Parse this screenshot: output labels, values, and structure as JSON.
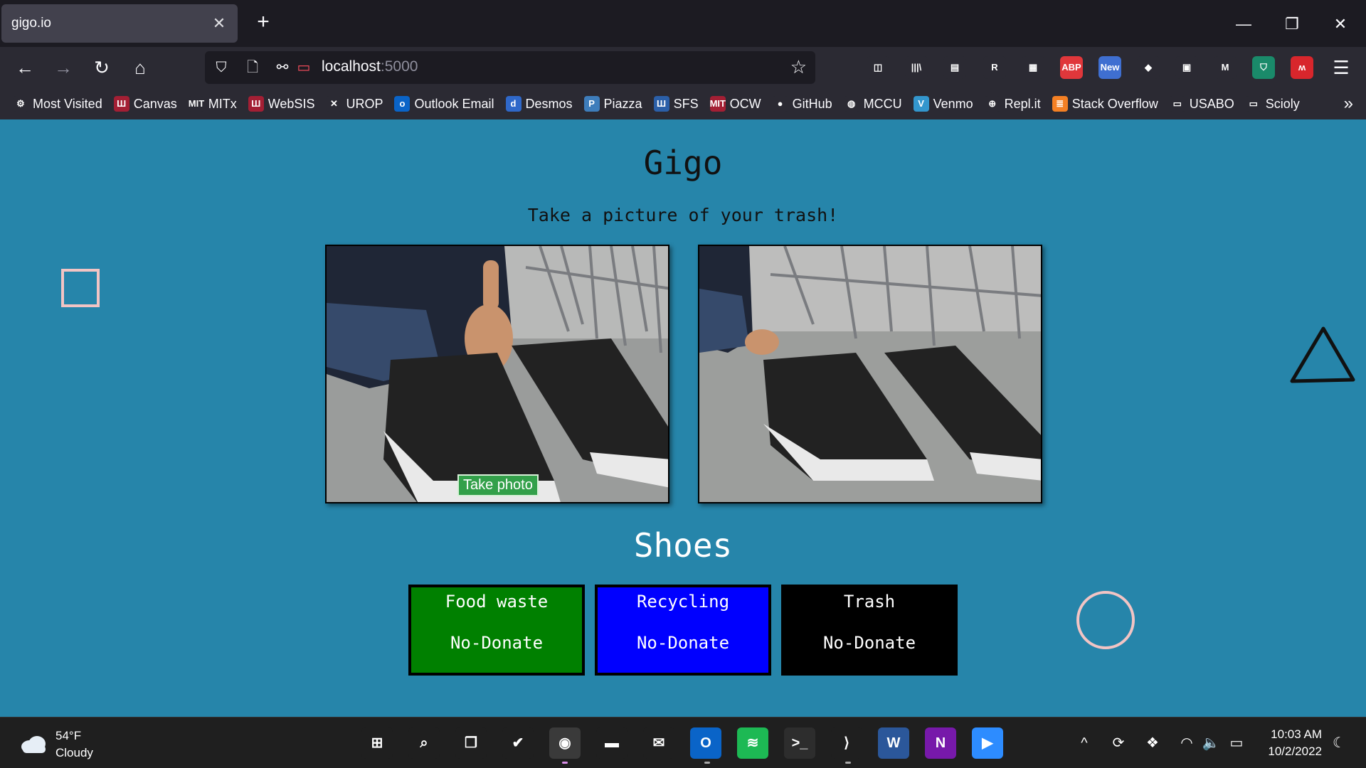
{
  "browser": {
    "tab_title": "gigo.io",
    "tab_close": "✕",
    "new_tab": "+",
    "url_host": "localhost",
    "url_port": ":5000",
    "window_controls": [
      "minimize-icon",
      "restore-icon",
      "close-icon"
    ],
    "nav_icons": [
      "back-arrow-icon",
      "forward-arrow-icon",
      "reload-icon",
      "home-icon"
    ],
    "extensions": [
      {
        "name": "pocket-icon",
        "label": "◫",
        "color": "#2b2a33"
      },
      {
        "name": "library-icon",
        "label": "|||\\",
        "color": "#2b2a33"
      },
      {
        "name": "sidebar-icon",
        "label": "▤",
        "color": "#2b2a33"
      },
      {
        "name": "readwise-extension-icon",
        "label": "R",
        "color": "#2b2a33"
      },
      {
        "name": "grid-extension-icon",
        "label": "▦",
        "color": "#2b2a33"
      },
      {
        "name": "adblock-plus-icon",
        "label": "ABP",
        "color": "#e0373b"
      },
      {
        "name": "new-extension-icon",
        "label": "New",
        "color": "#3f6fd1"
      },
      {
        "name": "gem-extension-icon",
        "label": "◆",
        "color": "#2b2a33"
      },
      {
        "name": "reader-extension-icon",
        "label": "▣",
        "color": "#2b2a33"
      },
      {
        "name": "m-extension-icon",
        "label": "M",
        "color": "#2b2a33"
      },
      {
        "name": "shield-extension-icon",
        "label": "⛉",
        "color": "#1a8a6a"
      },
      {
        "name": "mm-extension-icon",
        "label": "ʍ",
        "color": "#d8262c"
      }
    ],
    "menu_icon": "☰"
  },
  "bookmarks": [
    {
      "label": "Most Visited",
      "icon": "gear-icon",
      "glyph": "⚙",
      "color": "#2b2a33"
    },
    {
      "label": "Canvas",
      "icon": "canvas-icon",
      "glyph": "Ш",
      "color": "#a31f34"
    },
    {
      "label": "MITx",
      "icon": "mitx-icon",
      "glyph": "MIT",
      "color": "#2b2a33"
    },
    {
      "label": "WebSIS",
      "icon": "websis-icon",
      "glyph": "Ш",
      "color": "#a31f34"
    },
    {
      "label": "UROP",
      "icon": "urop-icon",
      "glyph": "✕",
      "color": "#2b2a33"
    },
    {
      "label": "Outlook Email",
      "icon": "outlook-icon",
      "glyph": "o",
      "color": "#0a64c8"
    },
    {
      "label": "Desmos",
      "icon": "desmos-icon",
      "glyph": "d",
      "color": "#2f68c9"
    },
    {
      "label": "Piazza",
      "icon": "piazza-icon",
      "glyph": "P",
      "color": "#3e7dbb"
    },
    {
      "label": "SFS",
      "icon": "sfs-icon",
      "glyph": "Ш",
      "color": "#2b5fa8"
    },
    {
      "label": "OCW",
      "icon": "ocw-icon",
      "glyph": "MIT",
      "color": "#a31f34"
    },
    {
      "label": "GitHub",
      "icon": "github-icon",
      "glyph": "●",
      "color": "#2b2a33"
    },
    {
      "label": "MCCU",
      "icon": "mccu-icon",
      "glyph": "◍",
      "color": "#2b2a33"
    },
    {
      "label": "Venmo",
      "icon": "venmo-icon",
      "glyph": "V",
      "color": "#3396cd"
    },
    {
      "label": "Repl.it",
      "icon": "globe-icon",
      "glyph": "⊕",
      "color": "#2b2a33"
    },
    {
      "label": "Stack Overflow",
      "icon": "stackoverflow-icon",
      "glyph": "≣",
      "color": "#f48024"
    },
    {
      "label": "USABO",
      "icon": "folder-icon",
      "glyph": "▭",
      "color": "#2b2a33"
    },
    {
      "label": "Scioly",
      "icon": "folder-icon",
      "glyph": "▭",
      "color": "#2b2a33"
    }
  ],
  "page": {
    "title": "Gigo",
    "subtitle": "Take a picture of your trash!",
    "take_photo": "Take photo",
    "result": "Shoes",
    "background": "#2685aa",
    "cards": [
      {
        "category": "Food waste",
        "donate": "No-Donate",
        "color": "#008000"
      },
      {
        "category": "Recycling",
        "donate": "No-Donate",
        "color": "#0000ff"
      },
      {
        "category": "Trash",
        "donate": "No-Donate",
        "color": "#000000"
      }
    ]
  },
  "taskbar": {
    "weather_temp": "54°F",
    "weather_desc": "Cloudy",
    "time": "10:03 AM",
    "date": "10/2/2022",
    "apps": [
      {
        "name": "start-icon",
        "glyph": "⊞",
        "color": "#1f1f1f"
      },
      {
        "name": "search-icon",
        "glyph": "⌕",
        "color": "#1f1f1f"
      },
      {
        "name": "task-view-icon",
        "glyph": "❐",
        "color": "#1f1f1f"
      },
      {
        "name": "todo-icon",
        "glyph": "✔",
        "color": "#1f1f1f"
      },
      {
        "name": "firefox-icon",
        "glyph": "◉",
        "color": "#3a3a3a"
      },
      {
        "name": "file-explorer-icon",
        "glyph": "▬",
        "color": "#1f1f1f"
      },
      {
        "name": "mail-icon",
        "glyph": "✉",
        "color": "#1f1f1f"
      },
      {
        "name": "outlook-icon",
        "glyph": "O",
        "color": "#0a64c8"
      },
      {
        "name": "spotify-icon",
        "glyph": "≋",
        "color": "#1db954"
      },
      {
        "name": "terminal-icon",
        "glyph": ">_",
        "color": "#2d2d2d"
      },
      {
        "name": "vscode-icon",
        "glyph": "⟩",
        "color": "#1f1f1f"
      },
      {
        "name": "word-icon",
        "glyph": "W",
        "color": "#2b579a"
      },
      {
        "name": "onenote-icon",
        "glyph": "N",
        "color": "#7719aa"
      },
      {
        "name": "zoom-icon",
        "glyph": "▶",
        "color": "#2d8cff"
      }
    ],
    "tray": [
      {
        "name": "chevron-up-icon",
        "glyph": "^"
      },
      {
        "name": "sync-icon",
        "glyph": "⟳"
      },
      {
        "name": "dropbox-icon",
        "glyph": "❖"
      },
      {
        "name": "wifi-icon",
        "glyph": "◠"
      },
      {
        "name": "volume-icon",
        "glyph": "🔈"
      },
      {
        "name": "battery-icon",
        "glyph": "▭"
      }
    ]
  }
}
